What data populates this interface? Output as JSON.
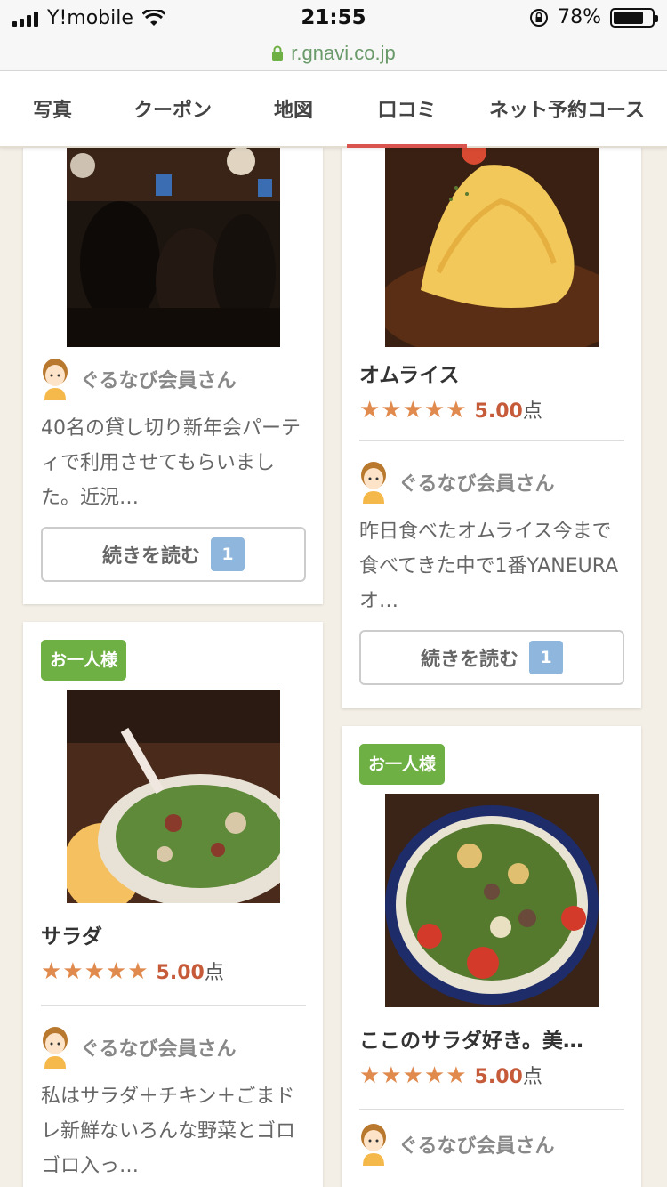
{
  "status": {
    "carrier": "Y!mobile",
    "time": "21:55",
    "battery": "78%",
    "battery_level": 0.78
  },
  "url": "r.gnavi.co.jp",
  "tabs": [
    {
      "label": "写真"
    },
    {
      "label": "クーポン"
    },
    {
      "label": "地図"
    },
    {
      "label": "口コミ",
      "active": true
    },
    {
      "label": "ネット予約コース"
    }
  ],
  "cards": [
    {
      "user": "ぐるなび会員さん",
      "comment": "40名の貸し切り新年会パーティで利用させてもらいました。近況…",
      "more_label": "続きを読む",
      "count": "1"
    },
    {
      "dish": "オムライス",
      "stars": "★★★★★",
      "score": "5.00",
      "unit": "点",
      "user": "ぐるなび会員さん",
      "comment": "昨日食べたオムライス今まで食べてきた中で1番YANEURAオ…",
      "more_label": "続きを読む",
      "count": "1"
    },
    {
      "badge": "お一人様",
      "dish": "サラダ",
      "stars": "★★★★★",
      "score": "5.00",
      "unit": "点",
      "user": "ぐるなび会員さん",
      "comment": "私はサラダ＋チキン＋ごまドレ新鮮ないろんな野菜とゴロゴロ入っ…"
    },
    {
      "badge": "お一人様",
      "dish": "ここのサラダ好き。美…",
      "stars": "★★★★★",
      "score": "5.00",
      "unit": "点",
      "user": "ぐるなび会員さん"
    }
  ]
}
